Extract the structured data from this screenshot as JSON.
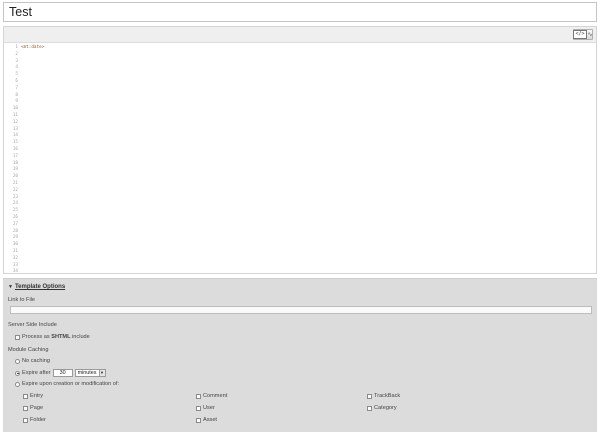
{
  "title_field": {
    "value": "Test"
  },
  "editor": {
    "toolbar": {
      "icon": "code-wave-icon"
    },
    "line_numbers": [
      "1",
      "2",
      "3",
      "4",
      "5",
      "6",
      "7",
      "8",
      "9",
      "10",
      "11",
      "12",
      "13",
      "14",
      "15",
      "16",
      "17",
      "18",
      "19",
      "20",
      "21",
      "22",
      "23",
      "24",
      "25",
      "26",
      "27",
      "28",
      "29",
      "30",
      "31",
      "32",
      "33",
      "34"
    ],
    "code": "<mt:date>"
  },
  "template_options": {
    "header": "Template Options",
    "link_to_file": {
      "label": "Link to File",
      "value": ""
    },
    "ssi": {
      "label": "Server Side Include",
      "process_prefix": "Process as ",
      "process_bold": "SHTML",
      "process_suffix": " include"
    },
    "module_caching": {
      "label": "Module Caching",
      "no_caching": "No caching",
      "expire_after": "Expire after",
      "expire_value": "30",
      "expire_unit": "minutes",
      "expire_event": "Expire upon creation or modification of:",
      "types": [
        "Entry",
        "Comment",
        "TrackBack",
        "Page",
        "User",
        "Category",
        "Folder",
        "Asset"
      ]
    }
  }
}
